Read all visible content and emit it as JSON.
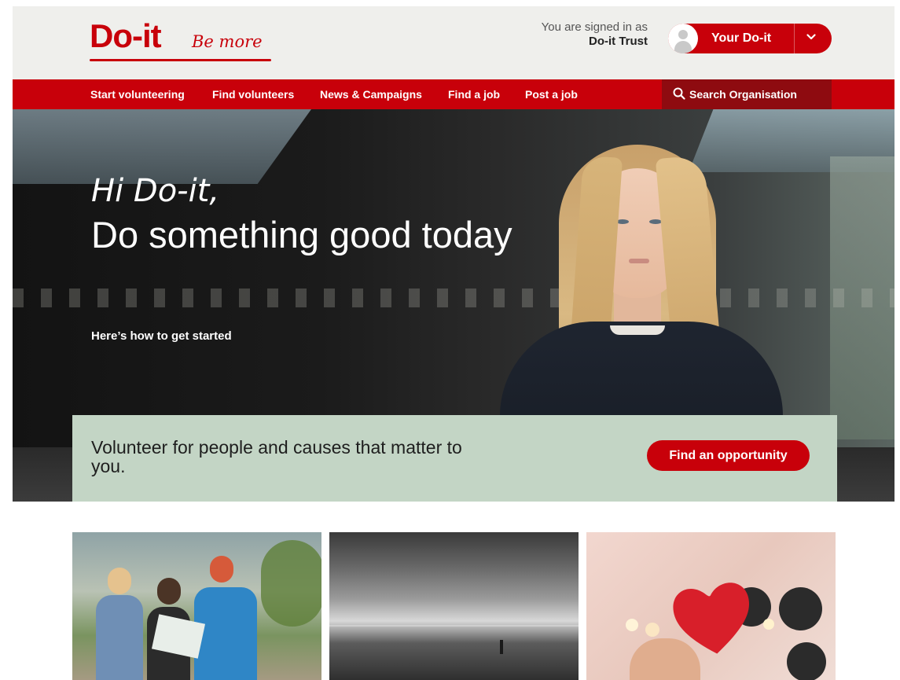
{
  "brand": {
    "logo_text": "Do-it",
    "tagline": "Be more",
    "color": "#c8000a"
  },
  "account": {
    "signed_in_label": "You are signed in as",
    "signed_in_name": "Do-it Trust",
    "menu_label": "Your Do-it",
    "avatar_icon": "user-avatar-icon",
    "chevron_icon": "chevron-down-icon"
  },
  "nav": {
    "items": [
      {
        "label": "Start volunteering"
      },
      {
        "label": "Find volunteers"
      },
      {
        "label": "News & Campaigns"
      },
      {
        "label": "Find a job"
      },
      {
        "label": "Post a job"
      }
    ],
    "search_label": "Search Organisation",
    "search_icon": "search-icon"
  },
  "hero": {
    "greeting": "Hi Do-it,",
    "title": "Do something good today",
    "subtitle": "Here’s how to get started"
  },
  "band": {
    "text": "Volunteer for people and causes that matter to you.",
    "button_label": "Find an opportunity",
    "background": "#c3d5c5"
  }
}
